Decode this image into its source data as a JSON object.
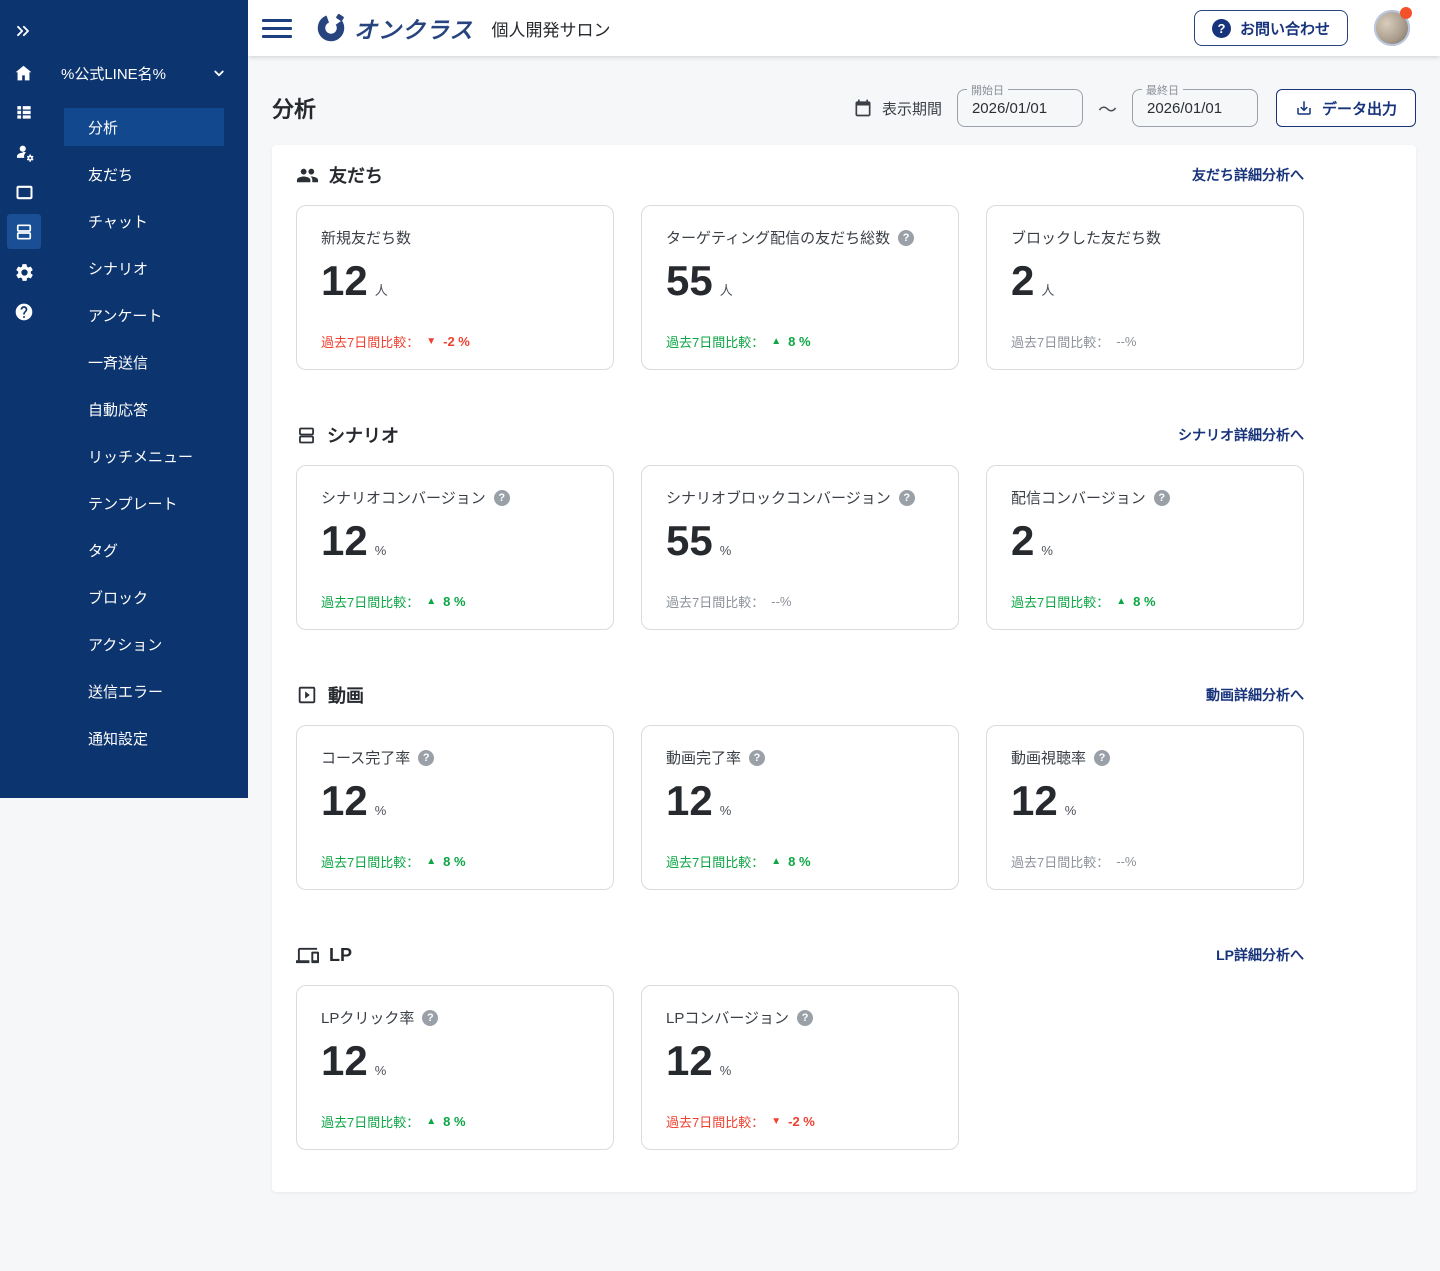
{
  "colors": {
    "sidebar_bg": "#0c346e",
    "sidebar_highlight": "#12488d",
    "brand_navy": "#17337c",
    "positive_green": "#0ca644",
    "negative_red": "#ef4130",
    "neutral_gray": "#8c919a",
    "notification_dot": "#f4502a",
    "page_bg": "#f6f7f9"
  },
  "header": {
    "brand_name": "オンクラス",
    "workspace_title": "個人開発サロン",
    "contact_label": "お問い合わせ"
  },
  "sidebar": {
    "collapse_icon": "chevrons-right",
    "workspace_label": "%公式LINE名%",
    "rail_icons": [
      "list",
      "user-gear",
      "window",
      "scenario",
      "settings",
      "help"
    ],
    "menu_items": [
      {
        "label": "分析",
        "active": true
      },
      {
        "label": "友だち",
        "active": false
      },
      {
        "label": "チャット",
        "active": false
      },
      {
        "label": "シナリオ",
        "active": false
      },
      {
        "label": "アンケート",
        "active": false
      },
      {
        "label": "一斉送信",
        "active": false
      },
      {
        "label": "自動応答",
        "active": false
      },
      {
        "label": "リッチメニュー",
        "active": false
      },
      {
        "label": "テンプレート",
        "active": false
      },
      {
        "label": "タグ",
        "active": false
      },
      {
        "label": "ブロック",
        "active": false
      },
      {
        "label": "アクション",
        "active": false
      },
      {
        "label": "送信エラー",
        "active": false
      },
      {
        "label": "通知設定",
        "active": false
      }
    ]
  },
  "toolbar": {
    "page_title": "分析",
    "period_label": "表示期間",
    "date_start": {
      "label": "開始日",
      "value": "2026/01/01"
    },
    "date_separator": "〜",
    "date_end": {
      "label": "最終日",
      "value": "2026/01/01"
    },
    "export_label": "データ出力"
  },
  "labels": {
    "comparison": "過去7日間比較："
  },
  "sections": [
    {
      "title": "友だち",
      "icon": "people",
      "link": "友だち詳細分析へ",
      "cards": [
        {
          "title": "新規友だち数",
          "help": false,
          "value": "12",
          "unit": "人",
          "trend": "down",
          "trend_value": "-2 %"
        },
        {
          "title": "ターゲティング配信の友だち総数",
          "help": true,
          "value": "55",
          "unit": "人",
          "trend": "up",
          "trend_value": "8 %"
        },
        {
          "title": "ブロックした友だち数",
          "help": false,
          "value": "2",
          "unit": "人",
          "trend": "none",
          "trend_value": "--%"
        }
      ]
    },
    {
      "title": "シナリオ",
      "icon": "scenario",
      "link": "シナリオ詳細分析へ",
      "cards": [
        {
          "title": "シナリオコンバージョン",
          "help": true,
          "value": "12",
          "unit": "%",
          "trend": "up",
          "trend_value": "8 %"
        },
        {
          "title": "シナリオブロックコンバージョン",
          "help": true,
          "value": "55",
          "unit": "%",
          "trend": "none",
          "trend_value": "--%"
        },
        {
          "title": "配信コンバージョン",
          "help": true,
          "value": "2",
          "unit": "%",
          "trend": "up",
          "trend_value": "8 %"
        }
      ]
    },
    {
      "title": "動画",
      "icon": "video",
      "link": "動画詳細分析へ",
      "cards": [
        {
          "title": "コース完了率",
          "help": true,
          "value": "12",
          "unit": "%",
          "trend": "up",
          "trend_value": "8 %"
        },
        {
          "title": "動画完了率",
          "help": true,
          "value": "12",
          "unit": "%",
          "trend": "up",
          "trend_value": "8 %"
        },
        {
          "title": "動画視聴率",
          "help": true,
          "value": "12",
          "unit": "%",
          "trend": "none",
          "trend_value": "--%"
        }
      ]
    },
    {
      "title": "LP",
      "icon": "devices",
      "link": "LP詳細分析へ",
      "cards": [
        {
          "title": "LPクリック率",
          "help": true,
          "value": "12",
          "unit": "%",
          "trend": "up",
          "trend_value": "8 %"
        },
        {
          "title": "LPコンバージョン",
          "help": true,
          "value": "12",
          "unit": "%",
          "trend": "down",
          "trend_value": "-2 %"
        }
      ]
    }
  ]
}
